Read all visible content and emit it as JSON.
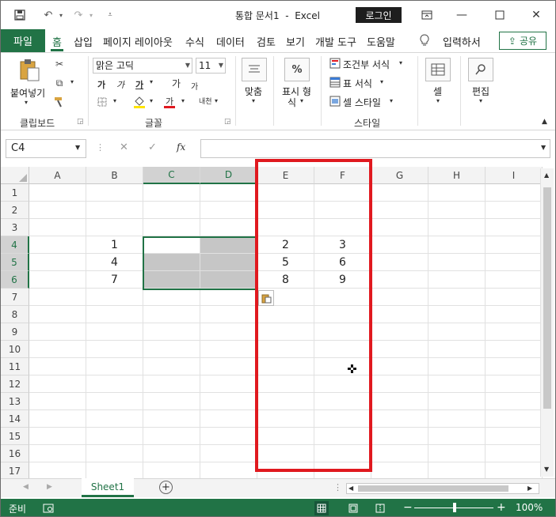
{
  "titlebar": {
    "title": "통합 문서1  -  Excel",
    "login": "로그인"
  },
  "tabs": {
    "file": "파일",
    "items": [
      "홈",
      "삽입",
      "페이지 레이아웃",
      "수식",
      "데이터",
      "검토",
      "보기",
      "개발 도구",
      "도움말"
    ],
    "tell_me": "입력하서",
    "share": "공유"
  },
  "ribbon": {
    "clipboard": {
      "paste": "붙여넣기",
      "label": "클립보드"
    },
    "font": {
      "name": "맑은 고딕",
      "size": "11",
      "label": "글꼴",
      "b": "가",
      "i": "가",
      "u": "가",
      "grow": "가",
      "shrink": "가",
      "phonetic": "내천"
    },
    "alignment": {
      "label": "맞춤"
    },
    "number": {
      "label": "표시 형식",
      "label_line1": "표시 형",
      "label_line2": "식",
      "symbol": "%"
    },
    "styles": {
      "conditional": "조건부 서식",
      "table": "표 서식",
      "cell": "셀 스타일",
      "label": "스타일"
    },
    "cells": {
      "label": "셀"
    },
    "editing": {
      "label": "편집"
    }
  },
  "formula_bar": {
    "name_box": "C4",
    "content": ""
  },
  "grid": {
    "columns": [
      "A",
      "B",
      "C",
      "D",
      "E",
      "F",
      "G",
      "H",
      "I"
    ],
    "rows": [
      "1",
      "2",
      "3",
      "4",
      "5",
      "6",
      "7",
      "8",
      "9",
      "10",
      "11",
      "12",
      "13",
      "14",
      "15",
      "16",
      "17"
    ],
    "cells": {
      "B4": "1",
      "B5": "4",
      "B6": "7",
      "E4": "2",
      "E5": "5",
      "E6": "8",
      "F4": "3",
      "F5": "6",
      "F6": "9"
    }
  },
  "sheets": [
    "Sheet1"
  ],
  "status": {
    "mode": "준비",
    "zoom": "100%"
  },
  "colors": {
    "accent": "#217346",
    "highlight": "#e0191f",
    "selection_fill": "#c6c6c6"
  }
}
